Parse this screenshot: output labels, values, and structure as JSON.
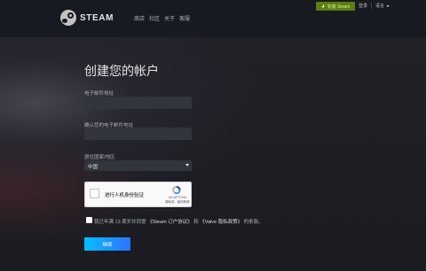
{
  "header": {
    "logo_text": "STEAM",
    "nav": [
      "商店",
      "社区",
      "关于",
      "客服"
    ],
    "install_label": "安装 Steam",
    "login_label": "登录",
    "language_label": "语言"
  },
  "form": {
    "title": "创建您的帐户",
    "email_label": "电子邮件地址",
    "email_value": "",
    "confirm_email_label": "确认您的电子邮件地址",
    "confirm_email_value": "",
    "country_label": "居住国家/地区",
    "country_value": "中国"
  },
  "captcha": {
    "label": "进行人机身份验证",
    "brand": "reCAPTCHA",
    "links": "隐私权 - 使用条款"
  },
  "agreement": {
    "pre": "我已年满 13 周岁并同意",
    "ssa": "《Steam 订户协议》",
    "mid": "和",
    "privacy": "《Valve 隐私政策》",
    "post": "的条款。"
  },
  "continue_label": "继续",
  "colors": {
    "install_green": "#5c7e10",
    "continue_gradient_start": "#06bfff",
    "continue_gradient_end": "#2d73ff",
    "header_bg": "#171a21"
  }
}
